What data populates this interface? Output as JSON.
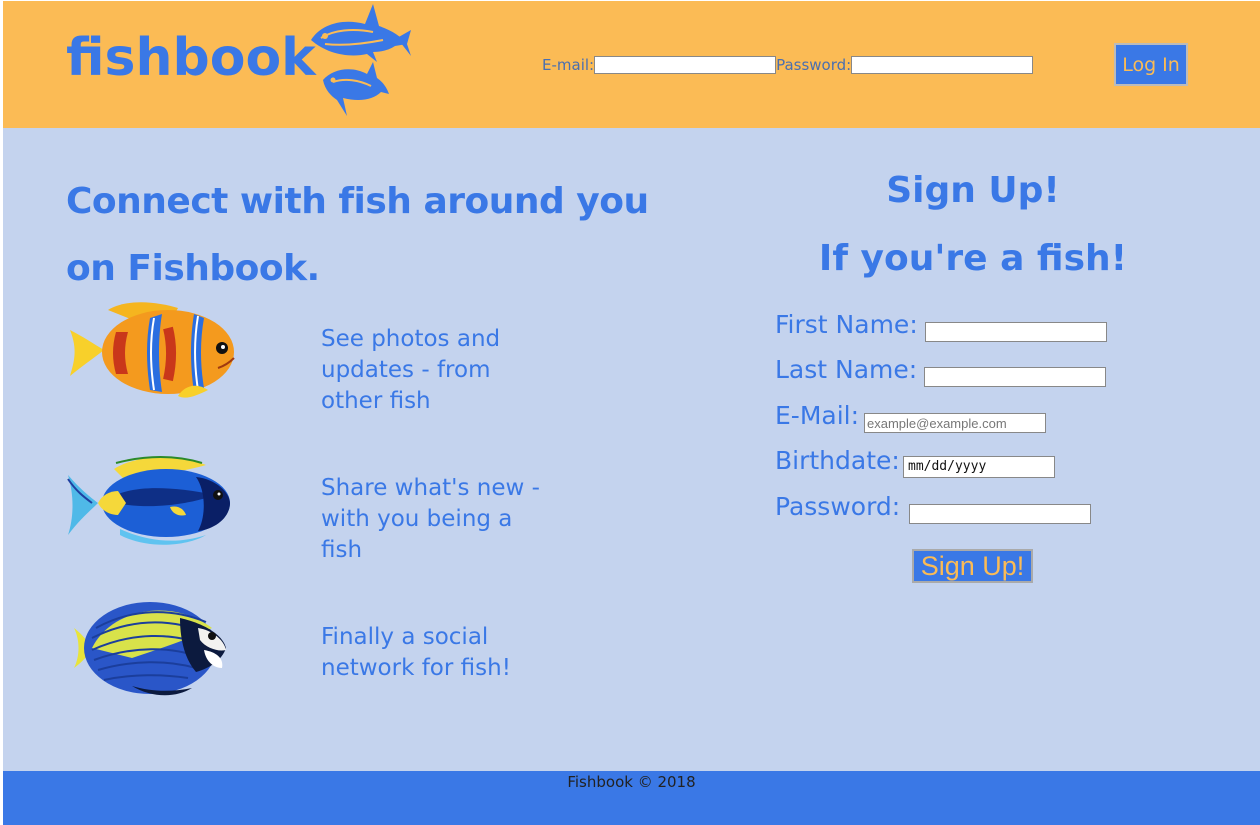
{
  "header": {
    "logo": "fishbook",
    "email_label": "E-mail:",
    "password_label": "Password:",
    "login_button": "Log In"
  },
  "main": {
    "headline_line1": "Connect with fish around you",
    "headline_line2": "on Fishbook.",
    "features": [
      {
        "line1": "See photos and",
        "line2": "updates - from",
        "line3": "other fish",
        "icon": "clownfish-image"
      },
      {
        "line1": "Share what's new -",
        "line2": "with you being a",
        "line3": "fish",
        "icon": "blue-tang-image"
      },
      {
        "line1": "Finally a social",
        "line2": "network for fish!",
        "icon": "angelfish-image"
      }
    ]
  },
  "signup": {
    "title": "Sign Up!",
    "subtitle": "If you're a fish!",
    "first_name_label": "First Name:",
    "last_name_label": "Last Name:",
    "email_label": "E-Mail:",
    "email_placeholder": "example@example.com",
    "birthdate_label": "Birthdate:",
    "birthdate_placeholder": "mm/dd/yyyy",
    "password_label": "Password:",
    "submit_button": "Sign Up!"
  },
  "footer": {
    "text": "Fishbook © 2018"
  },
  "colors": {
    "header_bg": "#fbbb55",
    "body_bg": "#c4d3ee",
    "accent_blue": "#3a78e6"
  }
}
